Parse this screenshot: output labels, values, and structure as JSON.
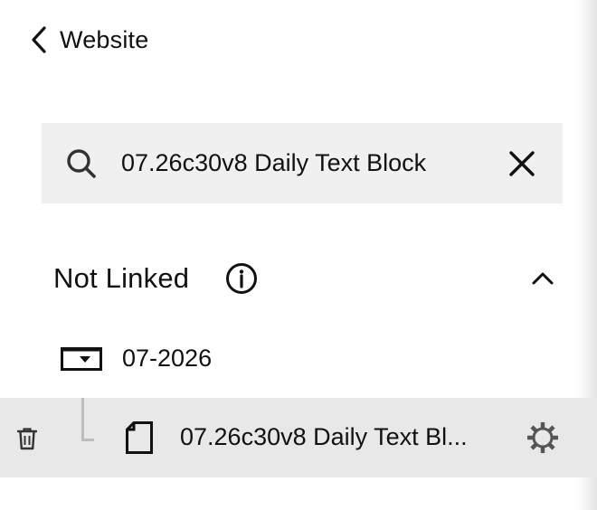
{
  "header": {
    "back_label": "Website",
    "back_icon": "chevron-left-icon"
  },
  "search": {
    "value": "07.26c30v8 Daily Text Block",
    "placeholder": "Search",
    "search_icon": "search-icon",
    "clear_icon": "close-icon"
  },
  "section": {
    "title": "Not Linked",
    "info_icon": "info-icon",
    "collapse_icon": "chevron-up-icon"
  },
  "tree": {
    "folder": {
      "label": "07-2026",
      "icon": "folder-icon"
    },
    "page": {
      "label": "07.26c30v8 Daily Text Bl...",
      "icon": "page-icon",
      "selected": true,
      "delete_icon": "trash-icon",
      "settings_icon": "gear-icon"
    }
  },
  "colors": {
    "text": "#111111",
    "search_bg": "#f0f0f0",
    "selected_row_bg": "#e8e8e8",
    "connector": "#bdbdbd",
    "icon_gray": "#555555"
  }
}
